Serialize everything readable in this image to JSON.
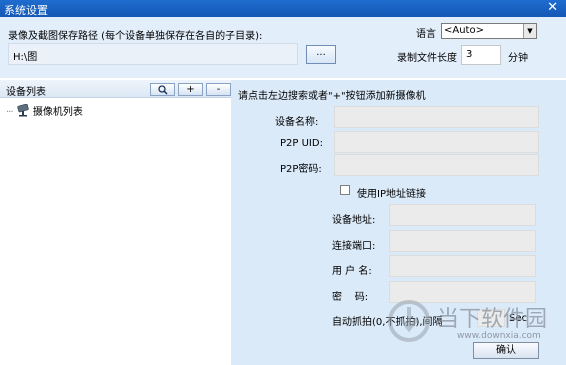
{
  "window": {
    "title": "系统设置",
    "close_glyph": "✕"
  },
  "top": {
    "path_label": "录像及截图保存路径 (每个设备单独保存在各自的子目录):",
    "path_value": "H:\\图",
    "browse_label": "...",
    "language_label": "语言",
    "language_value": "<Auto>",
    "record_length_label": "录制文件长度",
    "record_length_value": "3",
    "record_length_unit": "分钟"
  },
  "device_list": {
    "header": "设备列表",
    "search_glyph": "🔍",
    "add_label": "+",
    "remove_label": "-",
    "tree_root": "摄像机列表",
    "tree_connector": "···"
  },
  "form": {
    "hint": "请点击左边搜索或者\"+\"按钮添加新摄像机",
    "device_name_label": "设备名称:",
    "p2p_uid_label": "P2P UID:",
    "p2p_password_label": "P2P密码:",
    "use_ip_label": "使用IP地址链接",
    "device_address_label": "设备地址:",
    "port_label": "连接端口:",
    "username_label": "用 户 名:",
    "password_label": "密    码:",
    "auto_capture_label": "自动抓拍(0,不抓拍),间隔",
    "auto_capture_unit": "Sec",
    "confirm_label": "确认"
  },
  "watermark": {
    "brand": "当下软件园",
    "url": "www.downxia.com"
  },
  "colors": {
    "titlebar": "#1f6dd0",
    "panel": "#dbeaf9",
    "field": "#ebebeb"
  }
}
